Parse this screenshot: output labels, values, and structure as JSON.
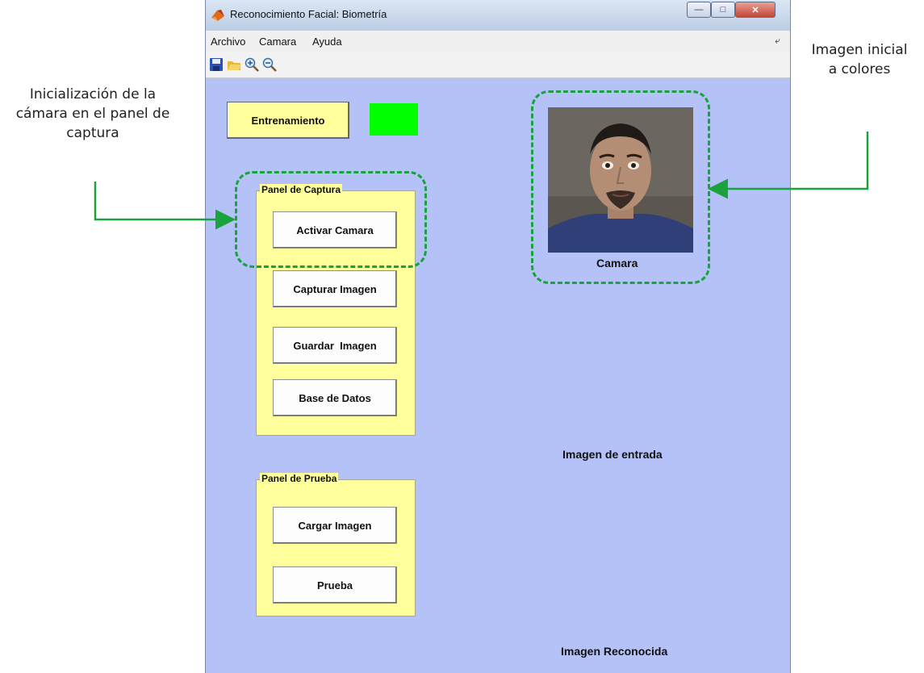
{
  "window": {
    "title": "Reconocimiento Facial: Biometría",
    "controls": [
      "minimize-icon",
      "maximize-icon",
      "close-icon"
    ]
  },
  "menu": {
    "items": [
      "Archivo",
      "Camara",
      "Ayuda"
    ],
    "overflow_icon": "arrow-icon"
  },
  "toolbar": {
    "icons": [
      "save-icon",
      "open-folder-icon",
      "zoom-in-icon",
      "zoom-out-icon"
    ]
  },
  "training": {
    "button_label": "Entrenamiento",
    "indicator_color": "#00ff00"
  },
  "capture_panel": {
    "title": "Panel de Captura",
    "buttons": [
      "Activar Camara",
      "Capturar Imagen",
      "Guardar  Imagen",
      "Base de Datos"
    ]
  },
  "test_panel": {
    "title": "Panel de Prueba",
    "buttons": [
      "Cargar Imagen",
      "Prueba"
    ]
  },
  "axes": {
    "camera_label": "Camara",
    "input_label": "Imagen de entrada",
    "recognized_label": "Imagen Reconocida"
  },
  "annotations": {
    "left": "Inicialización de la\ncámara en el panel de\ncaptura",
    "right": "Imagen inicial\na colores"
  },
  "colors": {
    "figure_background": "#b4c2f7",
    "panel_background": "#ffff9c",
    "highlight_dash": "#1aa33d"
  }
}
